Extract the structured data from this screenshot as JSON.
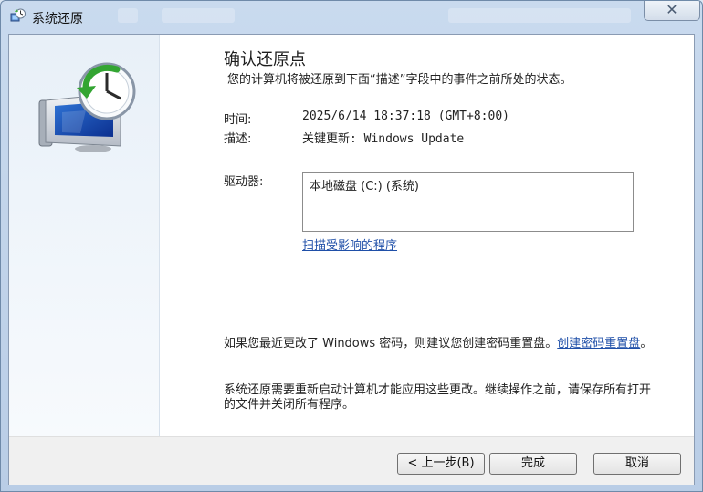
{
  "window": {
    "title": "系统还原",
    "close_glyph": "✕",
    "icon": "system-restore-icon"
  },
  "page": {
    "heading": "确认还原点",
    "subheading": "您的计算机将被还原到下面“描述”字段中的事件之前所处的状态。",
    "time_label": "时间:",
    "time_value": "2025/6/14 18:37:18 (GMT+8:00)",
    "desc_label": "描述:",
    "desc_value": "关键更新: Windows Update",
    "drive_label": "驱动器:",
    "drives": [
      "本地磁盘 (C:) (系统)"
    ],
    "scan_link": "扫描受影响的程序",
    "password_note": "如果您最近更改了 Windows 密码，则建议您创建密码重置盘。",
    "password_link": "创建密码重置盘",
    "password_note_end": "。",
    "restart_note": "系统还原需要重新启动计算机才能应用这些更改。继续操作之前，请保存所有打开的文件并关闭所有程序。"
  },
  "footer": {
    "back_label": "< 上一步(B)",
    "finish_label": "完成",
    "cancel_label": "取消"
  },
  "colors": {
    "link": "#1f4fa8",
    "titlebar": "#c9daee",
    "left_panel": "#e8f0f8"
  }
}
